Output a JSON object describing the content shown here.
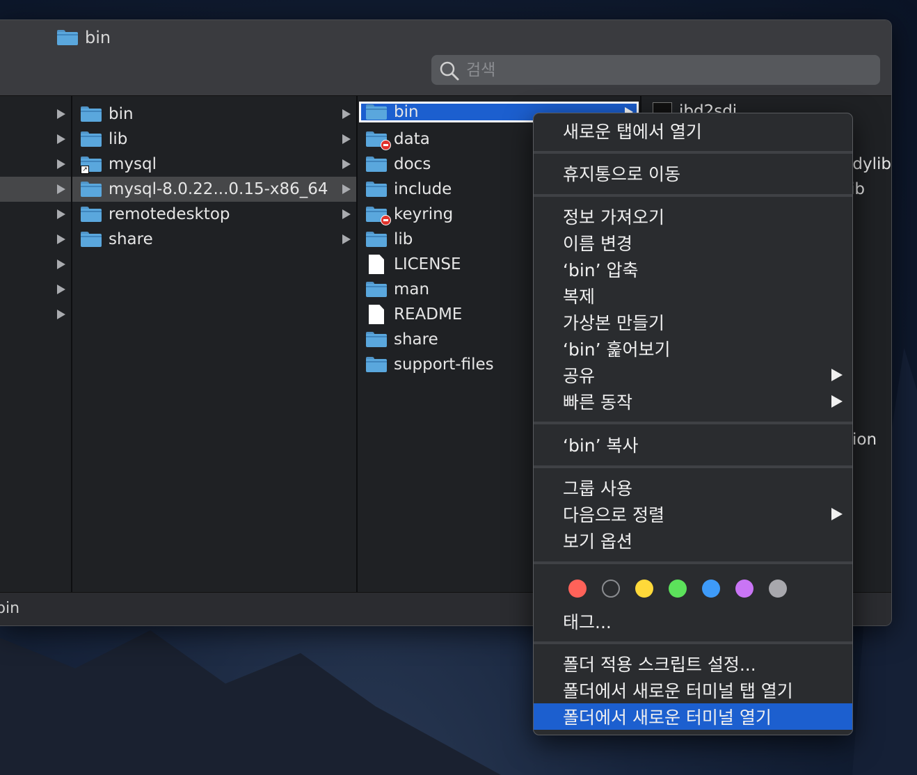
{
  "window": {
    "title": "bin"
  },
  "search": {
    "placeholder": "검색"
  },
  "column1": {
    "rows": [
      {
        "name": "bin",
        "has_children": true,
        "selected": false
      },
      {
        "name": "lib",
        "has_children": true,
        "selected": false
      },
      {
        "name": "mysql",
        "has_children": true,
        "selected": false
      },
      {
        "name": "mysql-8.0.22...0.15-x86_64",
        "has_children": true,
        "selected": true
      },
      {
        "name": "remotedesktop",
        "has_children": true,
        "selected": false
      },
      {
        "name": "share",
        "has_children": true,
        "selected": false
      }
    ]
  },
  "column2": {
    "rows": [
      {
        "name": "bin",
        "selected": true
      },
      {
        "name": "data"
      },
      {
        "name": "docs"
      },
      {
        "name": "include"
      },
      {
        "name": "keyring"
      },
      {
        "name": "lib"
      },
      {
        "name": "LICENSE"
      },
      {
        "name": "man"
      },
      {
        "name": "README"
      },
      {
        "name": "share"
      },
      {
        "name": "support-files"
      }
    ]
  },
  "column3": {
    "visible_fragments": [
      "ibd2sdi",
      ".dylib",
      "ib",
      "ion"
    ]
  },
  "statusbar": {
    "path": "bin"
  },
  "context_menu": {
    "open_in_new_tab": "새로운 탭에서 열기",
    "move_to_trash": "휴지통으로 이동",
    "get_info": "정보 가져오기",
    "rename": "이름 변경",
    "compress": "‘bin’ 압축",
    "duplicate": "복제",
    "make_alias": "가상본 만들기",
    "quick_look": "‘bin’ 훑어보기",
    "share": "공유",
    "quick_actions": "빠른 동작",
    "copy": "‘bin’ 복사",
    "use_groups": "그룹 사용",
    "sort_by": "다음으로 정렬",
    "view_options": "보기 옵션",
    "tags": "태그...",
    "folder_actions_setup": "폴더 적용 스크립트 설정...",
    "new_terminal_tab": "폴더에서 새로운 터미널 탭 열기",
    "new_terminal": "폴더에서 새로운 터미널 열기",
    "tag_colors": [
      "#ff6259",
      "none",
      "#ffd93a",
      "#5ce25b",
      "#3e9bf9",
      "#c975f5",
      "#a8a8ad"
    ]
  }
}
